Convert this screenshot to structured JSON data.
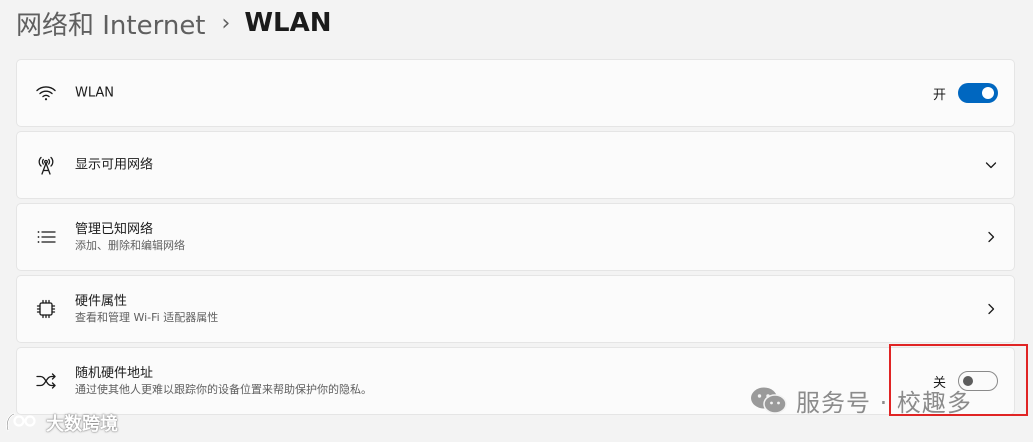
{
  "breadcrumb": {
    "parent": "网络和 Internet",
    "separator": "›",
    "current": "WLAN"
  },
  "rows": {
    "wlan": {
      "title": "WLAN",
      "state_label": "开",
      "toggle_on": true,
      "icon": "wifi-icon"
    },
    "available_networks": {
      "title": "显示可用网络",
      "icon": "antenna-icon",
      "action_icon": "chevron-down-icon"
    },
    "known_networks": {
      "title": "管理已知网络",
      "subtitle": "添加、删除和编辑网络",
      "icon": "list-icon",
      "action_icon": "chevron-right-icon"
    },
    "hardware_properties": {
      "title": "硬件属性",
      "subtitle": "查看和管理 Wi-Fi 适配器属性",
      "icon": "chip-icon",
      "action_icon": "chevron-right-icon"
    },
    "random_hardware_address": {
      "title": "随机硬件地址",
      "subtitle": "通过使其他人更难以跟踪你的设备位置来帮助保护你的隐私。",
      "state_label": "关",
      "toggle_on": false,
      "icon": "shuffle-icon"
    }
  },
  "watermarks": {
    "right": "服务号 · 校趣多",
    "left": "大数跨境"
  },
  "colors": {
    "accent": "#0067c0",
    "highlight_border": "#e02424",
    "background": "#f3f3f3",
    "card": "#fbfbfb"
  }
}
